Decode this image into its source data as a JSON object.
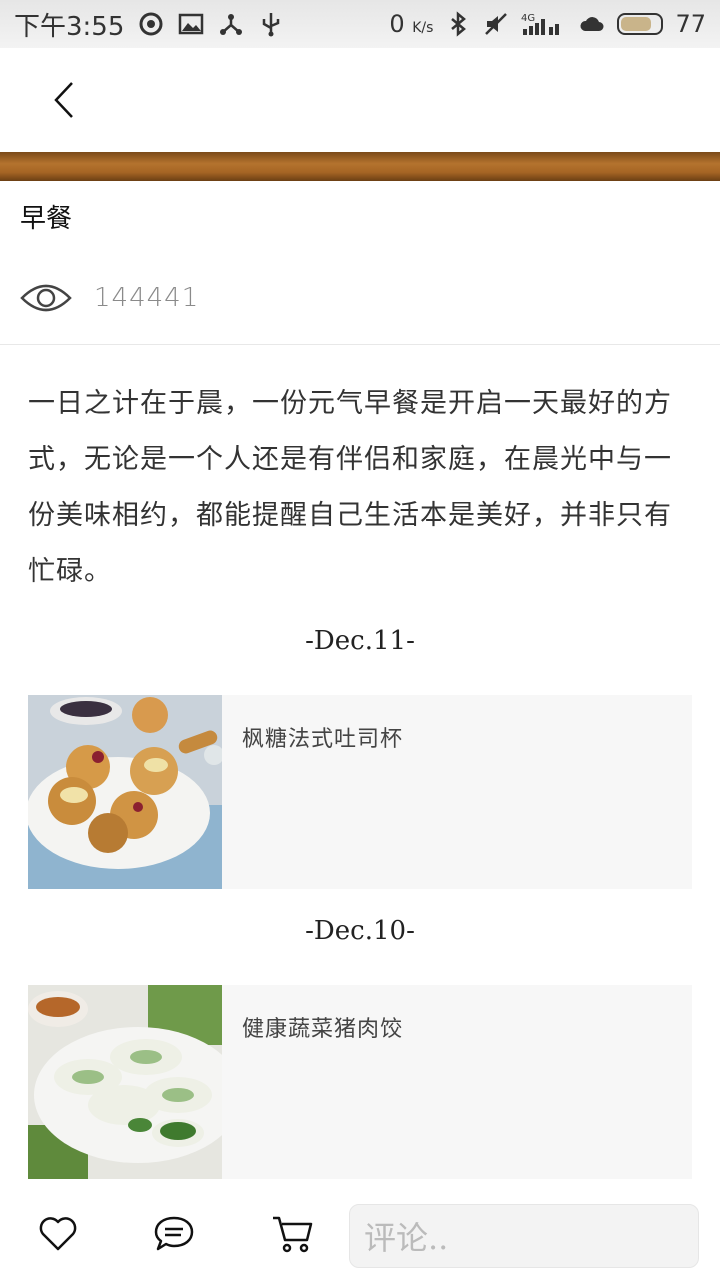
{
  "status_bar": {
    "time": "下午3:55",
    "net_speed": "0",
    "net_unit": "K/s",
    "battery_level": "77",
    "battery_fraction": 0.77
  },
  "header": {
    "back_icon": "chevron-left-icon"
  },
  "article": {
    "title": "早餐",
    "views": "144441",
    "intro": "一日之计在于晨，一份元气早餐是开启一天最好的方式，无论是一个人还是有伴侣和家庭，在晨光中与一份美味相约，都能提醒自己生活本是美好，并非只有忙碌。"
  },
  "entries": [
    {
      "date": "-Dec.11-",
      "title": "枫糖法式吐司杯"
    },
    {
      "date": "-Dec.10-",
      "title": "健康蔬菜猪肉饺"
    }
  ],
  "bottom_bar": {
    "comment_placeholder": "评论.."
  },
  "colors": {
    "card_bg": "#f7f7f7",
    "banner": "#a66524"
  }
}
